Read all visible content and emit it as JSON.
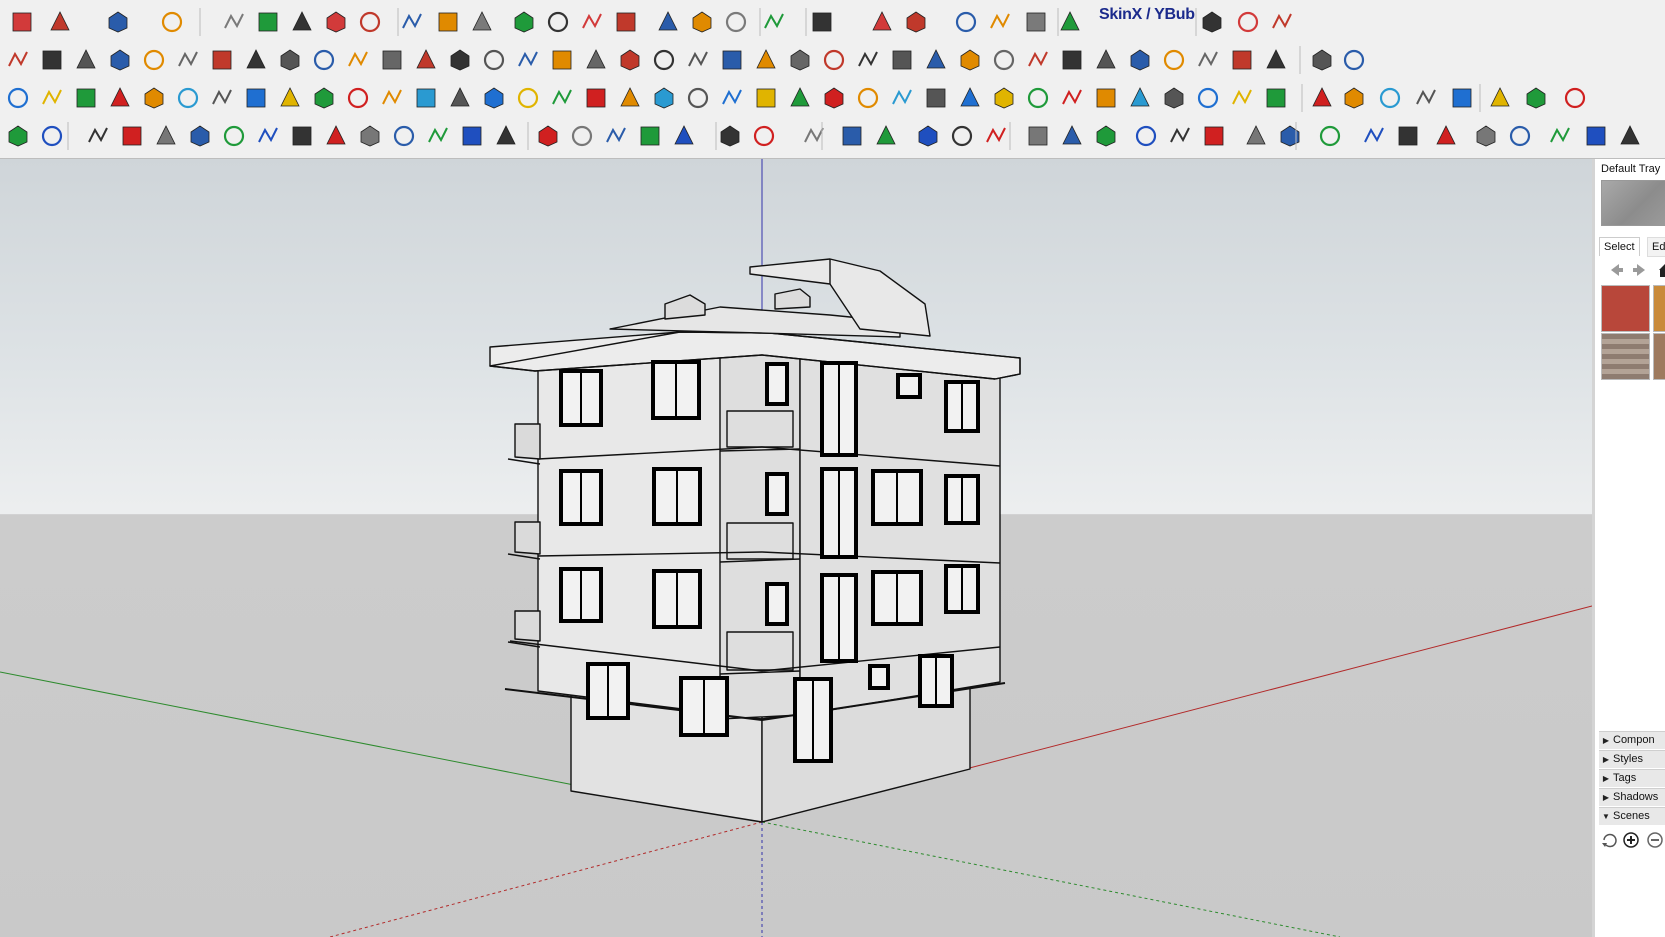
{
  "toolbar": {
    "skinx_label": "SkinX / YBub"
  },
  "tray": {
    "title": "Default Tray",
    "materials": {
      "tab_select": "Select",
      "tab_edit": "Edit"
    },
    "panels": [
      {
        "label": "Compon",
        "state": "collapsed"
      },
      {
        "label": "Styles",
        "state": "collapsed"
      },
      {
        "label": "Tags",
        "state": "collapsed"
      },
      {
        "label": "Shadows",
        "state": "collapsed"
      },
      {
        "label": "Scenes",
        "state": "expanded"
      }
    ]
  },
  "icons": {
    "row1": [
      "eraser-icon",
      "pencil-icon",
      "arc-icon",
      "rectangle-icon",
      "push-pull-icon",
      "follow-me-icon",
      "move-icon",
      "rotate-icon",
      "scale-icon",
      "tape-measure-icon",
      "text-icon",
      "paint-bucket-icon",
      "orbit-icon",
      "pan-icon",
      "zoom-icon",
      "zoom-extents-icon",
      "sandbox-icon",
      "layers-icon",
      "stack-icon",
      "warehouse-icon",
      "profile-icon",
      "model-info-icon",
      "skinx-icon",
      "play-icon",
      "stop-icon",
      "help-icon"
    ],
    "colors": {
      "accent_red": "#d02020",
      "accent_blue": "#1f4fbf",
      "accent_green": "#1f9a3a",
      "accent_orange": "#e08a00"
    }
  },
  "scene": {
    "axis_colors": {
      "x": "#b22a2a",
      "y": "#2e8b2e",
      "z": "#3333aa"
    },
    "sky_color": "#dde2e5",
    "ground_color": "#c9c9c9"
  }
}
